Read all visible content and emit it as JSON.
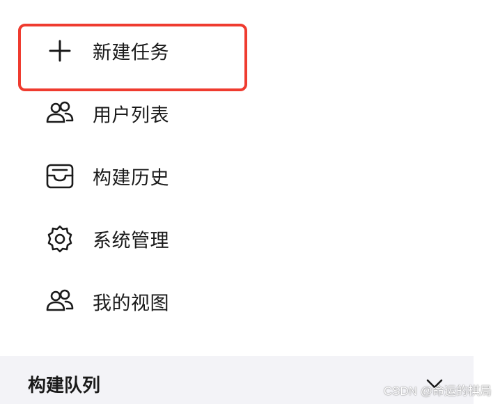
{
  "menu": {
    "items": [
      {
        "label": "新建任务",
        "icon": "plus-icon"
      },
      {
        "label": "用户列表",
        "icon": "users-icon"
      },
      {
        "label": "构建历史",
        "icon": "inbox-icon"
      },
      {
        "label": "系统管理",
        "icon": "gear-icon"
      },
      {
        "label": "我的视图",
        "icon": "users-icon"
      }
    ],
    "highlight_color": "#ef3b2f"
  },
  "queue": {
    "title": "构建队列",
    "icon": "chevron-down-icon"
  },
  "watermark": {
    "text": "CSDN @命运的棋局"
  }
}
